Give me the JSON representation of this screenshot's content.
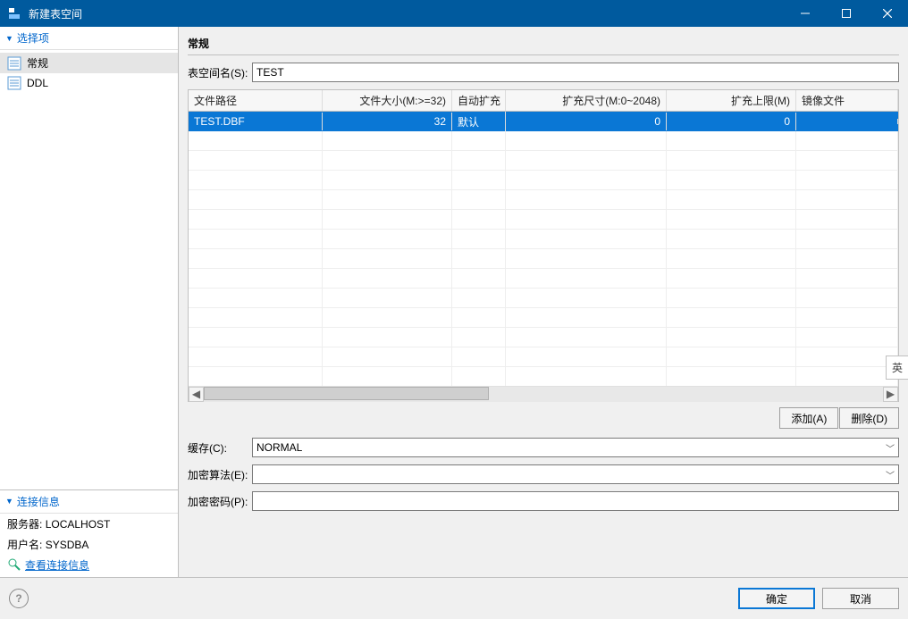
{
  "window": {
    "title": "新建表空间"
  },
  "sidebar": {
    "options_header": "选择项",
    "items": [
      {
        "label": "常规",
        "selected": true
      },
      {
        "label": "DDL",
        "selected": false
      }
    ],
    "conn_header": "连接信息",
    "server_label": "服务器:",
    "server_value": "LOCALHOST",
    "user_label": "用户名:",
    "user_value": "SYSDBA",
    "view_conn_link": "查看连接信息"
  },
  "main": {
    "section_title": "常规",
    "tablespace_name_label": "表空间名(S):",
    "tablespace_name_value": "TEST",
    "table": {
      "columns": {
        "file_path": "文件路径",
        "file_size": "文件大小(M:>=32)",
        "auto_extend": "自动扩充",
        "extend_size": "扩充尺寸(M:0~2048)",
        "extend_limit": "扩充上限(M)",
        "mirror_file": "镜像文件"
      },
      "rows": [
        {
          "file_path": "TEST.DBF",
          "file_size": "32",
          "auto_extend": "默认",
          "extend_size": "0",
          "extend_limit": "0",
          "mirror_file": ""
        }
      ]
    },
    "actions": {
      "add": "添加(A)",
      "delete": "删除(D)"
    },
    "cache_label": "缓存(C):",
    "cache_value": "NORMAL",
    "enc_alg_label": "加密算法(E):",
    "enc_alg_value": "",
    "enc_pwd_label": "加密密码(P):",
    "enc_pwd_value": ""
  },
  "footer": {
    "ok": "确定",
    "cancel": "取消"
  },
  "ime": {
    "label": "英"
  }
}
